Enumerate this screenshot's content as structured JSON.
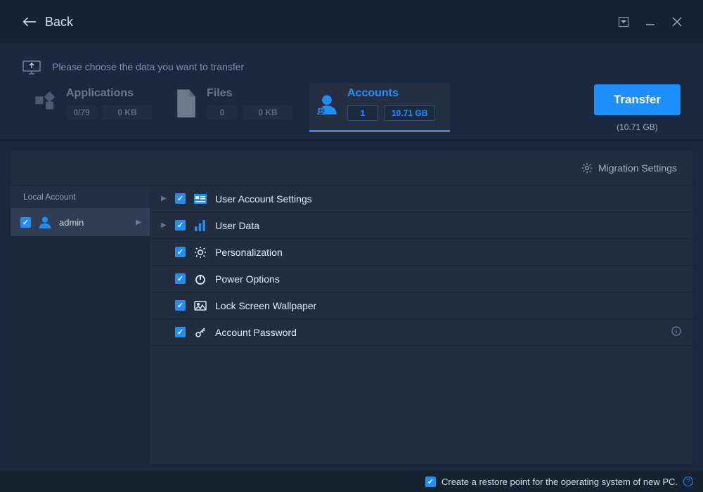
{
  "header": {
    "back_label": "Back"
  },
  "prompt": {
    "text": "Please choose the data you want to transfer"
  },
  "tabs": {
    "applications": {
      "title": "Applications",
      "count": "0/79",
      "size": "0 KB"
    },
    "files": {
      "title": "Files",
      "count": "0",
      "size": "0 KB"
    },
    "accounts": {
      "title": "Accounts",
      "count": "1",
      "size": "10.71 GB"
    }
  },
  "transfer": {
    "button": "Transfer",
    "total_size": "(10.71 GB)"
  },
  "settings_link": "Migration Settings",
  "sidebar": {
    "header": "Local Account",
    "user": "admin"
  },
  "items": [
    {
      "label": "User Account Settings",
      "expandable": true
    },
    {
      "label": "User Data",
      "expandable": true
    },
    {
      "label": "Personalization",
      "expandable": false
    },
    {
      "label": "Power Options",
      "expandable": false
    },
    {
      "label": "Lock Screen Wallpaper",
      "expandable": false
    },
    {
      "label": "Account Password",
      "expandable": false,
      "has_info": true
    }
  ],
  "footer": {
    "restore_label": "Create a restore point for the operating system of new PC."
  }
}
